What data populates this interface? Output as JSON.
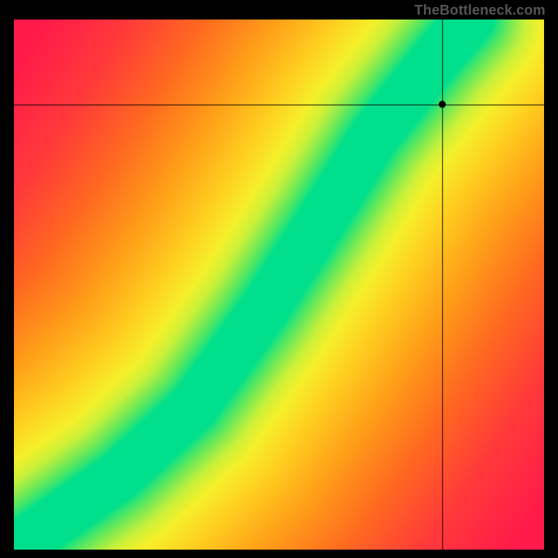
{
  "watermark": "TheBottleneck.com",
  "chart_data": {
    "type": "heatmap",
    "title": "",
    "xlabel": "",
    "ylabel": "",
    "xlim": [
      0,
      1
    ],
    "ylim": [
      0,
      1
    ],
    "grid": false,
    "legend": false,
    "crosshair": {
      "x": 0.808,
      "y": 0.84
    },
    "marker": {
      "x": 0.808,
      "y": 0.84
    },
    "curve_control_points": [
      {
        "x": 0.0,
        "y": 0.0
      },
      {
        "x": 0.2,
        "y": 0.14
      },
      {
        "x": 0.34,
        "y": 0.27
      },
      {
        "x": 0.47,
        "y": 0.45
      },
      {
        "x": 0.58,
        "y": 0.62
      },
      {
        "x": 0.68,
        "y": 0.78
      },
      {
        "x": 0.8,
        "y": 0.93
      },
      {
        "x": 0.86,
        "y": 1.0
      }
    ],
    "color_stops": [
      {
        "t": 0.0,
        "color": "#00e08c"
      },
      {
        "t": 0.07,
        "color": "#64e85a"
      },
      {
        "t": 0.14,
        "color": "#c8f03a"
      },
      {
        "t": 0.2,
        "color": "#f5f02a"
      },
      {
        "t": 0.3,
        "color": "#ffd020"
      },
      {
        "t": 0.45,
        "color": "#ffa018"
      },
      {
        "t": 0.62,
        "color": "#ff6a20"
      },
      {
        "t": 0.8,
        "color": "#ff3a3a"
      },
      {
        "t": 1.0,
        "color": "#ff1a4a"
      }
    ],
    "band_half_width": 0.045,
    "falloff_scale": 0.6
  }
}
